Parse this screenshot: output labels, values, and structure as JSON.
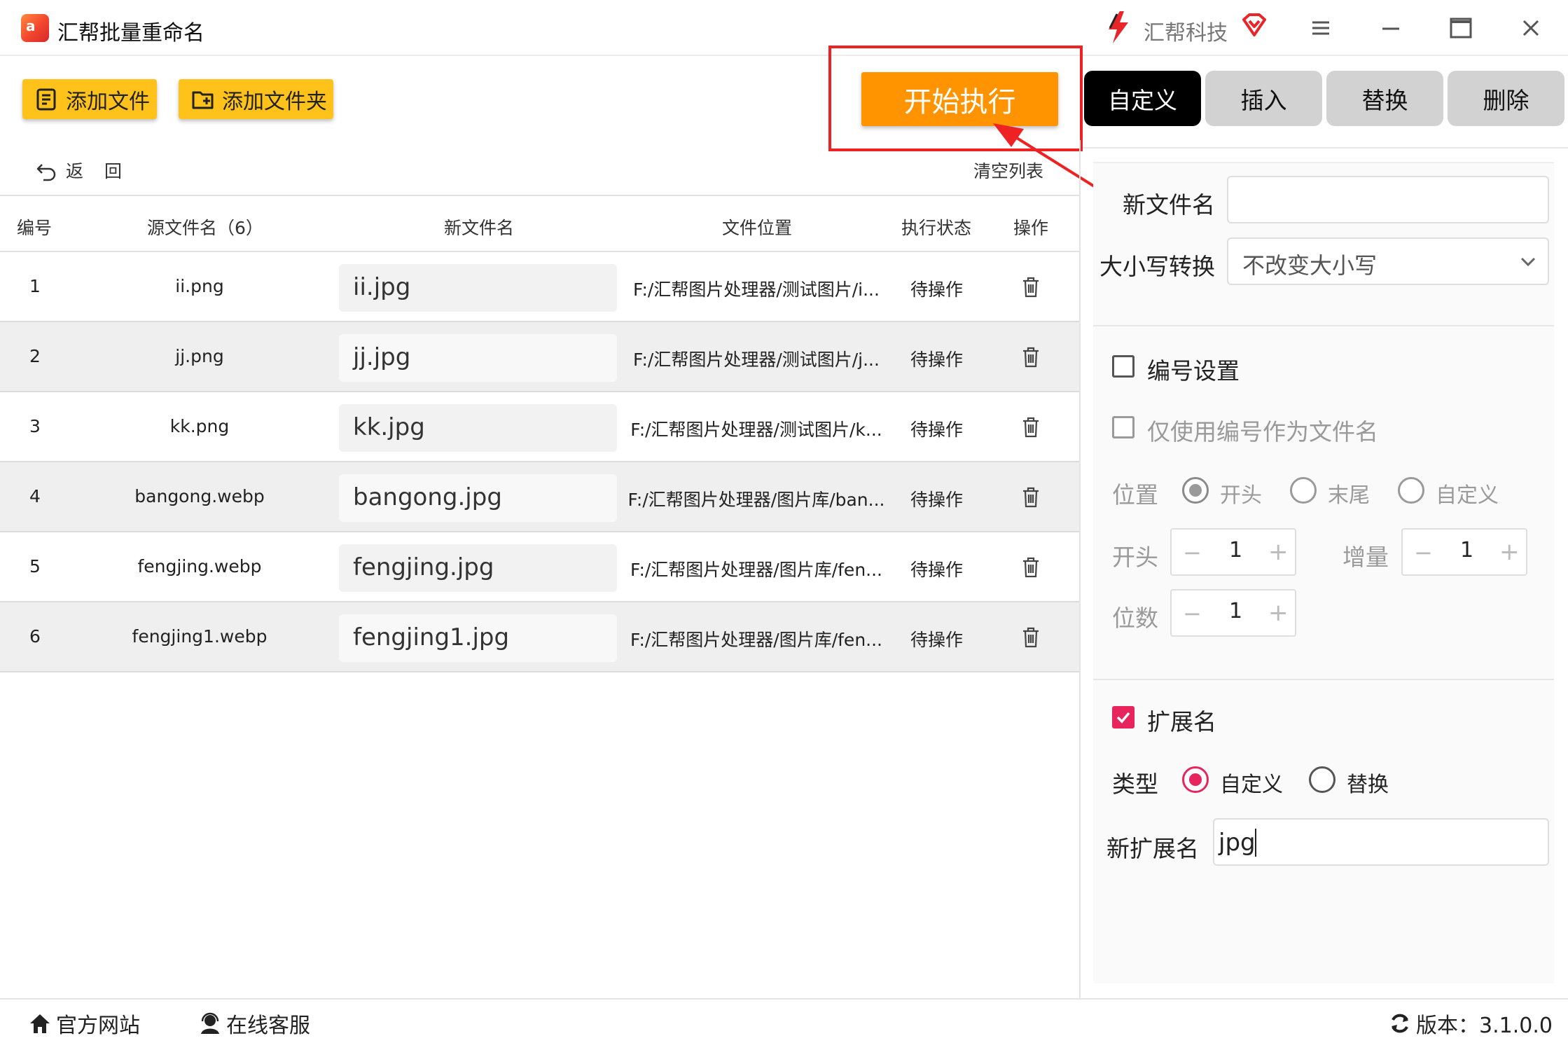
{
  "titlebar": {
    "app_title": "汇帮批量重命名",
    "brand_name": "汇帮科技"
  },
  "toolbar": {
    "add_file_label": "添加文件",
    "add_folder_label": "添加文件夹",
    "start_label": "开始执行",
    "back_label": "返回",
    "clear_list_label": "清空列表"
  },
  "tabs": [
    {
      "label": "自定义",
      "active": true
    },
    {
      "label": "插入",
      "active": false
    },
    {
      "label": "替换",
      "active": false
    },
    {
      "label": "删除",
      "active": false
    }
  ],
  "table": {
    "headers": {
      "num": "编号",
      "source": "源文件名（6）",
      "new_name": "新文件名",
      "location": "文件位置",
      "status": "执行状态",
      "op": "操作"
    },
    "rows": [
      {
        "num": "1",
        "source": "ii.png",
        "new_name": "ii.jpg",
        "location": "F:/汇帮图片处理器/测试图片/i...",
        "status": "待操作"
      },
      {
        "num": "2",
        "source": "jj.png",
        "new_name": "jj.jpg",
        "location": "F:/汇帮图片处理器/测试图片/j...",
        "status": "待操作"
      },
      {
        "num": "3",
        "source": "kk.png",
        "new_name": "kk.jpg",
        "location": "F:/汇帮图片处理器/测试图片/k...",
        "status": "待操作"
      },
      {
        "num": "4",
        "source": "bangong.webp",
        "new_name": "bangong.jpg",
        "location": "F:/汇帮图片处理器/图片库/ban...",
        "status": "待操作"
      },
      {
        "num": "5",
        "source": "fengjing.webp",
        "new_name": "fengjing.jpg",
        "location": "F:/汇帮图片处理器/图片库/fen...",
        "status": "待操作"
      },
      {
        "num": "6",
        "source": "fengjing1.webp",
        "new_name": "fengjing1.jpg",
        "location": "F:/汇帮图片处理器/图片库/fen...",
        "status": "待操作"
      }
    ]
  },
  "panel": {
    "new_filename_label": "新文件名",
    "new_filename_value": "",
    "case_label": "大小写转换",
    "case_value": "不改变大小写",
    "numbering": {
      "label": "编号设置",
      "checked": false,
      "only_number_label": "仅使用编号作为文件名",
      "position_label": "位置",
      "position_options": [
        "开头",
        "末尾",
        "自定义"
      ],
      "position_selected": "开头",
      "start_label": "开头",
      "start_value": "1",
      "increment_label": "增量",
      "increment_value": "1",
      "digits_label": "位数",
      "digits_value": "1",
      "minus_symbol": "−",
      "plus_symbol": "+"
    },
    "extension": {
      "label": "扩展名",
      "checked": true,
      "type_label": "类型",
      "type_options": [
        "自定义",
        "替换"
      ],
      "type_selected": "自定义",
      "new_ext_label": "新扩展名",
      "new_ext_value": "jpg"
    }
  },
  "footer": {
    "site_label": "官方网站",
    "service_label": "在线客服",
    "version_label": "版本：3.1.0.0"
  },
  "colors": {
    "yellow_button": "#ffc21a",
    "start_button": "#ff9400",
    "highlight_red": "#ee2222",
    "accent_pink": "#e8245e"
  }
}
